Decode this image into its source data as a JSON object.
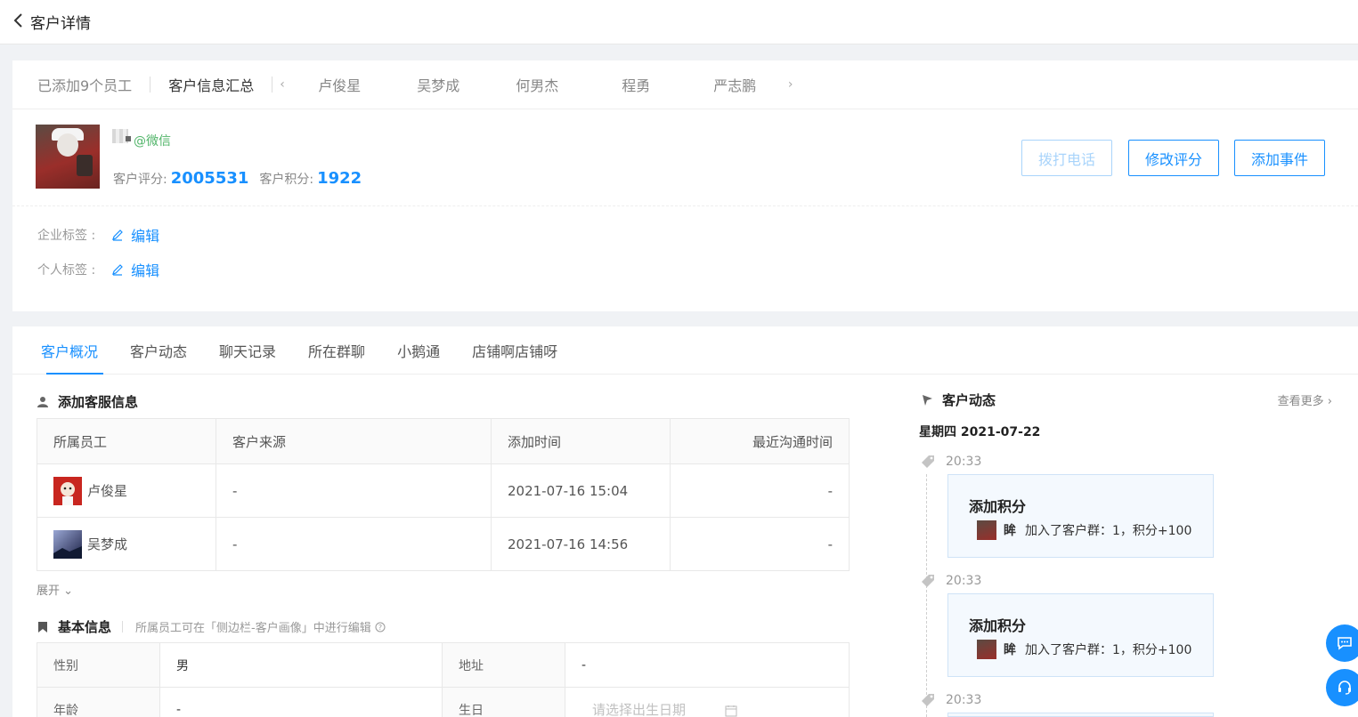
{
  "header": {
    "back_icon": "chevron-left-icon",
    "title": "客户详情"
  },
  "staff_bar": {
    "added_label": "已添加9个员工",
    "summary_label": "客户信息汇总",
    "prev_arrow": "‹",
    "next_arrow": "›",
    "staff": [
      "卢俊星",
      "吴梦成",
      "何男杰",
      "程勇",
      "严志鹏"
    ]
  },
  "customer": {
    "source": "@微信",
    "score_label": "客户评分:",
    "score_value": "2005531",
    "points_label": "客户积分:",
    "points_value": "1922"
  },
  "actions": {
    "call": "拨打电话",
    "edit_score": "修改评分",
    "add_event": "添加事件"
  },
  "tags": {
    "enterprise_label": "企业标签 :",
    "personal_label": "个人标签 :",
    "edit_label": "编辑"
  },
  "tabs": [
    "客户概况",
    "客户动态",
    "聊天记录",
    "所在群聊",
    "小鹅通",
    "店铺啊店铺呀"
  ],
  "service_info": {
    "title": "添加客服信息",
    "columns": [
      "所属员工",
      "客户来源",
      "添加时间",
      "最近沟通时间"
    ],
    "rows": [
      {
        "employee": "卢俊星",
        "source": "-",
        "added": "2021-07-16 15:04",
        "last": "-"
      },
      {
        "employee": "吴梦成",
        "source": "-",
        "added": "2021-07-16 14:56",
        "last": "-"
      }
    ],
    "expand_label": "展开 ⌄"
  },
  "basic_info": {
    "title": "基本信息",
    "note": "所属员工可在「侧边栏-客户画像」中进行编辑",
    "gender_label": "性别",
    "gender_value": "男",
    "address_label": "地址",
    "address_value": "-",
    "age_label": "年龄",
    "age_value": "-",
    "birthday_label": "生日",
    "birthday_placeholder": "请选择出生日期"
  },
  "dynamics": {
    "title": "客户动态",
    "more_label": "查看更多 ›",
    "date": "星期四 2021-07-22",
    "events": [
      {
        "time": "20:33",
        "title": "添加积分",
        "user": "眸",
        "desc": "加入了客户群：1，积分+100"
      },
      {
        "time": "20:33",
        "title": "添加积分",
        "user": "眸",
        "desc": "加入了客户群：1，积分+100"
      },
      {
        "time": "20:33"
      }
    ]
  },
  "colors": {
    "primary": "#1890ff",
    "wechat": "#52b56a"
  }
}
